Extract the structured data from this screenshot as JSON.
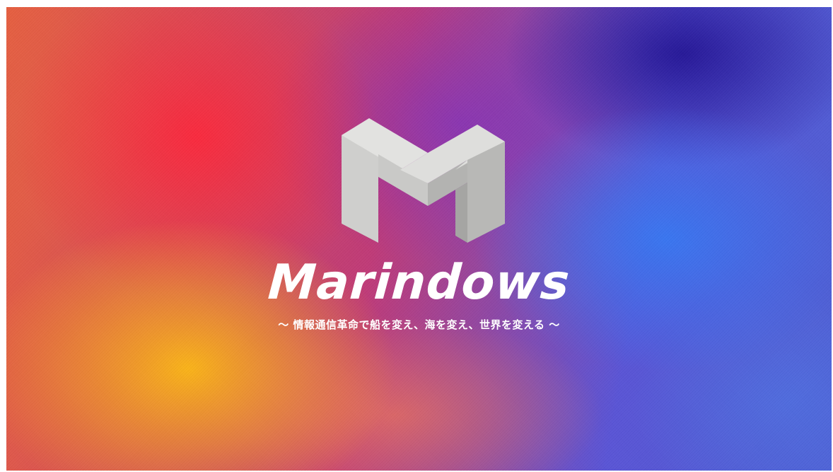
{
  "hero": {
    "brand_name": "Marindows",
    "tagline": "〜 情報通信革命で船を変え、海を変え、世界を変える 〜",
    "logo_icon": "m-letter-logo-icon"
  },
  "colors": {
    "logo_top_face": "#dcdcda",
    "logo_front_face": "#c8c8c6",
    "logo_shadow_face": "#a9a9a7",
    "text": "#ffffff",
    "gradient_orange": "#ffba14",
    "gradient_red": "#ff283c",
    "gradient_purple": "#8232be",
    "gradient_blue": "#3778f5",
    "gradient_navy": "#231496"
  }
}
